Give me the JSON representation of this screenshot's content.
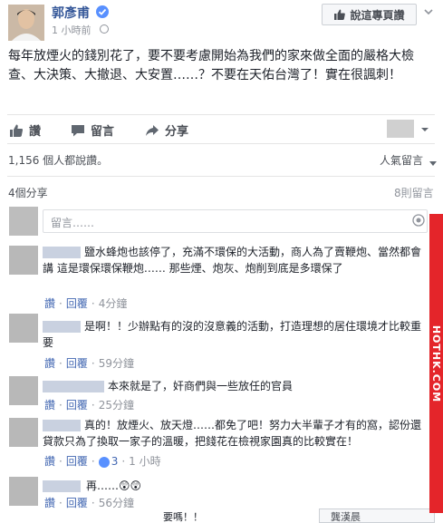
{
  "post": {
    "author": "郭彥甫",
    "timestamp": "1 小時前",
    "like_page_label": "說這專頁讚",
    "text": "每年放煙火的錢別花了，要不要考慮開始為我們的家來做全面的嚴格大檢查、大決策、大撤退、大安置……？不要在天佑台灣了！實在很諷刺！"
  },
  "actions": {
    "like": "讚",
    "comment": "留言",
    "share": "分享"
  },
  "stats": {
    "likes": "1,156 個人都說讚。",
    "sort": "人氣留言",
    "shares": "4個分享",
    "comments": "8則留言"
  },
  "comment_box": {
    "placeholder": "留言……"
  },
  "comments": [
    {
      "text": "鹽水蜂炮也該停了，充滿不環保的大活動，商人為了賣鞭炮、當然都會講 這是環保環保鞭炮…… 那些煙、炮灰、炮削到底是多環保了",
      "like": "讚",
      "reply": "回覆",
      "time": "4分鐘"
    },
    {
      "text": "是啊！！少辦點有的沒的沒意義的活動，打造理想的居住環境才比較重要",
      "like": "讚",
      "reply": "回覆",
      "time": "59分鐘"
    },
    {
      "text": "本來就是了，奸商們與一些放任的官員",
      "like": "讚",
      "reply": "回覆",
      "time": "25分鐘"
    },
    {
      "text": "真的！放煙火、放天燈……都免了吧！努力大半輩子才有的窩，認份還貸款只為了換取一家子的溫暖，把錢花在檢視家園真的比較實在！",
      "like": "讚",
      "reply": "回覆",
      "likes_count": "3",
      "time": "1 小時"
    },
    {
      "text": "再……😲😲",
      "like": "讚",
      "reply": "回覆",
      "time": "56分鐘"
    }
  ],
  "partial_texts": {
    "bottom_left": "要嗎！！",
    "bottom_box": "龔漢晨"
  },
  "watermark": "HOTHK.COM",
  "colors": {
    "link_blue": "#365899",
    "action_blue": "#4267b2",
    "meta_gray": "#90949c",
    "watermark_red": "#e4252a"
  },
  "icons": [
    "verified-badge-icon",
    "globe-icon",
    "like-thumb-icon",
    "chevron-down-icon",
    "comment-icon",
    "share-icon",
    "camera-icon",
    "like-reaction-icon"
  ]
}
